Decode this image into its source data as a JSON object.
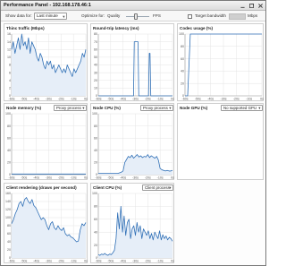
{
  "window": {
    "title": "Performance Panel - 192.168.178.46:1"
  },
  "toolbar": {
    "show_data_label": "Show data for:",
    "show_data_value": "Last minute",
    "optimize_label": "Optimize for:",
    "quality_label": "Quality",
    "fps_label": "FPS",
    "target_bandwidth_label": "Target bandwidth",
    "bandwidth_value": "",
    "mbps_label": "Mbps"
  },
  "colors": {
    "line": "#2f6fb6",
    "fill": "#e6eef8",
    "grid": "#e4e4e4",
    "axis": "#9a9a9a"
  },
  "panels": {
    "thinc": {
      "title": "Thinc traffic (Mbps)"
    },
    "roundtrip": {
      "title": "Round-trip latency (ms)"
    },
    "codec": {
      "title": "Codec usage (%)"
    },
    "node_memory": {
      "title": "Node memory (%)",
      "select": "Proxy process"
    },
    "node_cpu": {
      "title": "Node CPU (%)",
      "select": "Proxy process"
    },
    "node_gpu": {
      "title": "Node GPU (%)",
      "select": "No supported GPU"
    },
    "client_render": {
      "title": "Client rendering (draws per second)"
    },
    "client_cpu": {
      "title": "Client CPU (%)",
      "select": "Client process"
    }
  },
  "chart_data": [
    {
      "id": "thinc",
      "type": "area",
      "title": "Thinc traffic (Mbps)",
      "x": [
        "-60s",
        "-50s",
        "-40s",
        "-30s",
        "-20s",
        "-10s",
        "0s"
      ],
      "y_ticks": [
        "0",
        "2",
        "4",
        "6",
        "8",
        "10",
        "12",
        "14",
        "16"
      ],
      "ylim": [
        0,
        16
      ],
      "values": [
        12,
        14,
        11,
        13,
        15,
        12,
        16,
        13,
        14,
        12,
        15,
        11,
        14,
        13,
        12,
        10,
        9,
        11,
        10,
        8,
        7,
        9,
        8,
        9,
        7,
        8,
        6,
        7,
        8,
        7,
        6,
        7,
        6,
        8,
        7,
        6,
        5,
        7,
        6,
        7,
        8,
        9,
        11,
        10,
        12
      ]
    },
    {
      "id": "roundtrip",
      "type": "line",
      "title": "Round-trip latency (ms)",
      "x": [
        "-60s",
        "-50s",
        "-40s",
        "-30s",
        "-20s",
        "-10s",
        "0s"
      ],
      "y_ticks": [
        "0",
        "10",
        "20",
        "30",
        "40",
        "50",
        "60",
        "70",
        "80"
      ],
      "ylim": [
        0,
        80
      ],
      "values": [
        0,
        0,
        0,
        0,
        0,
        0,
        0,
        0,
        0,
        0,
        0,
        0,
        0,
        0,
        0,
        0,
        0,
        0,
        0,
        0,
        0,
        0,
        0,
        0,
        0,
        0,
        0,
        0,
        0,
        0,
        0,
        0,
        0,
        0,
        0,
        0,
        0,
        0,
        0,
        0,
        0,
        0,
        0,
        0,
        0,
        0,
        0,
        0,
        70,
        70,
        70,
        70,
        70,
        70,
        0,
        0,
        0,
        0,
        0,
        0,
        0,
        0,
        0,
        0,
        0,
        0,
        0,
        0,
        55,
        55,
        0,
        0,
        0,
        0,
        0,
        0,
        0,
        0,
        0,
        0,
        0,
        0,
        0,
        0,
        0,
        0,
        0,
        0,
        0,
        0,
        0,
        0,
        0,
        0,
        0,
        0,
        0,
        0,
        0,
        0
      ]
    },
    {
      "id": "codec",
      "type": "line",
      "title": "Codec usage (%)",
      "x": [
        "-60s",
        "-50s",
        "-40s",
        "-30s",
        "-20s",
        "-10s",
        "0s"
      ],
      "y_ticks": [
        "0",
        "20",
        "40",
        "60",
        "80",
        "100"
      ],
      "ylim": [
        0,
        100
      ],
      "series": [
        {
          "values": [
            0,
            0,
            100,
            100,
            100,
            100,
            100,
            100,
            100,
            100,
            100,
            100,
            100,
            100,
            100,
            100,
            100,
            100,
            100,
            100,
            100,
            100,
            100,
            100,
            100,
            100,
            100,
            100,
            100,
            100
          ]
        }
      ]
    },
    {
      "id": "node_memory",
      "type": "line",
      "title": "Node memory (%)",
      "x": [
        "-60s",
        "-50s",
        "-40s",
        "-30s",
        "-20s",
        "-10s",
        "0s"
      ],
      "y_ticks": [
        "0",
        "20",
        "40",
        "60",
        "80",
        "100"
      ],
      "ylim": [
        0,
        100
      ],
      "values": [
        1,
        1,
        1,
        1,
        1,
        1,
        1,
        1,
        1,
        1,
        1,
        1,
        1,
        1,
        1,
        1,
        1,
        1,
        1,
        1
      ]
    },
    {
      "id": "node_cpu",
      "type": "area",
      "title": "Node CPU (%)",
      "x": [
        "-60s",
        "-50s",
        "-40s",
        "-30s",
        "-20s",
        "-10s",
        "0s"
      ],
      "y_ticks": [
        "0",
        "20",
        "40",
        "60",
        "80",
        "100"
      ],
      "ylim": [
        0,
        100
      ],
      "values": [
        2,
        2,
        2,
        2,
        2,
        2,
        2,
        2,
        2,
        2,
        2,
        2,
        3,
        4,
        6,
        20,
        25,
        30,
        28,
        32,
        27,
        30,
        33,
        29,
        31,
        28,
        30,
        29,
        33,
        28,
        31,
        29,
        27,
        30,
        24,
        10,
        8,
        7,
        6,
        7,
        6,
        6,
        7
      ]
    },
    {
      "id": "client_render",
      "type": "area",
      "title": "Client rendering (draws per second)",
      "x": [
        "-60s",
        "-50s",
        "-40s",
        "-30s",
        "-20s",
        "-10s",
        "0s"
      ],
      "y_ticks": [
        "0",
        "20",
        "40",
        "60",
        "80",
        "100",
        "120",
        "140",
        "160"
      ],
      "ylim": [
        0,
        160
      ],
      "values": [
        85,
        95,
        110,
        120,
        135,
        140,
        128,
        145,
        150,
        140,
        135,
        145,
        130,
        125,
        115,
        105,
        95,
        100,
        95,
        80,
        70,
        85,
        90,
        75,
        70,
        80,
        72,
        68,
        75,
        60,
        55,
        58,
        52,
        50,
        45,
        40,
        42,
        70,
        85,
        80,
        88
      ]
    },
    {
      "id": "client_cpu",
      "type": "area",
      "title": "Client CPU (%)",
      "x": [
        "-60s",
        "-50s",
        "-40s",
        "-30s",
        "-20s",
        "-10s",
        "0s"
      ],
      "y_ticks": [
        "0",
        "20",
        "40",
        "60",
        "80",
        "100"
      ],
      "ylim": [
        0,
        100
      ],
      "values": [
        5,
        4,
        6,
        5,
        7,
        5,
        4,
        6,
        5,
        8,
        12,
        30,
        70,
        45,
        80,
        40,
        65,
        35,
        55,
        60,
        30,
        45,
        50,
        35,
        55,
        40,
        50,
        30,
        45,
        40,
        35,
        42,
        30,
        38,
        28,
        40,
        35,
        30,
        42,
        28,
        36,
        30,
        34,
        28,
        32,
        30,
        26
      ]
    }
  ]
}
